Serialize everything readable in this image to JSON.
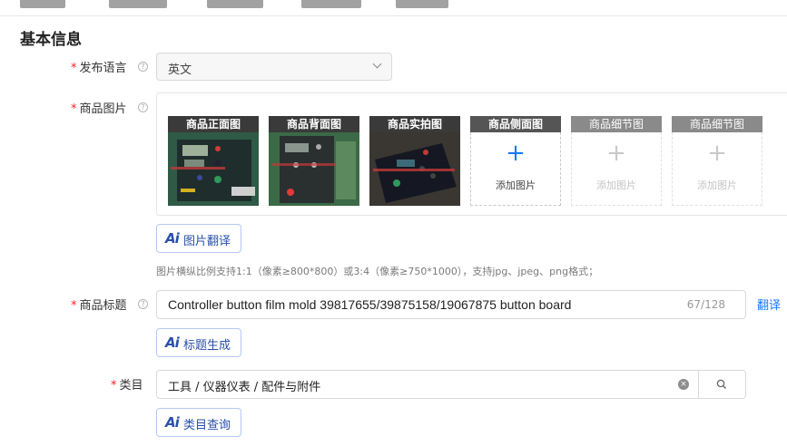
{
  "section": {
    "title": "基本信息"
  },
  "language": {
    "label": "发布语言",
    "value": "英文"
  },
  "images": {
    "label": "商品图片",
    "slots": [
      {
        "caption": "商品正面图",
        "state": "filled"
      },
      {
        "caption": "商品背面图",
        "state": "filled"
      },
      {
        "caption": "商品实拍图",
        "state": "filled"
      },
      {
        "caption": "商品侧面图",
        "state": "empty",
        "add_label": "添加图片"
      },
      {
        "caption": "商品细节图",
        "state": "disabled",
        "add_label": "添加图片"
      },
      {
        "caption": "商品细节图",
        "state": "disabled",
        "add_label": "添加图片"
      }
    ],
    "translate_button": "图片翻译",
    "hint": "图片横纵比例支持1:1（像素≥800*800）或3:4（像素≥750*1000），支持jpg、jpeg、png格式；"
  },
  "product_title": {
    "label": "商品标题",
    "value": "Controller button film mold 39817655/39875158/19067875 button board",
    "count": "67/128",
    "translate_link": "翻译",
    "generate_button": "标题生成"
  },
  "category": {
    "label": "类目",
    "value": "工具 / 仪器仪表 / 配件与附件",
    "query_button": "类目查询"
  },
  "icons": {
    "ai": "Ai",
    "help": "?",
    "plus": "+",
    "clear": "×"
  },
  "colors": {
    "accent": "#1677ff",
    "required": "#f5222d",
    "ai_text": "#2a4fa8"
  }
}
